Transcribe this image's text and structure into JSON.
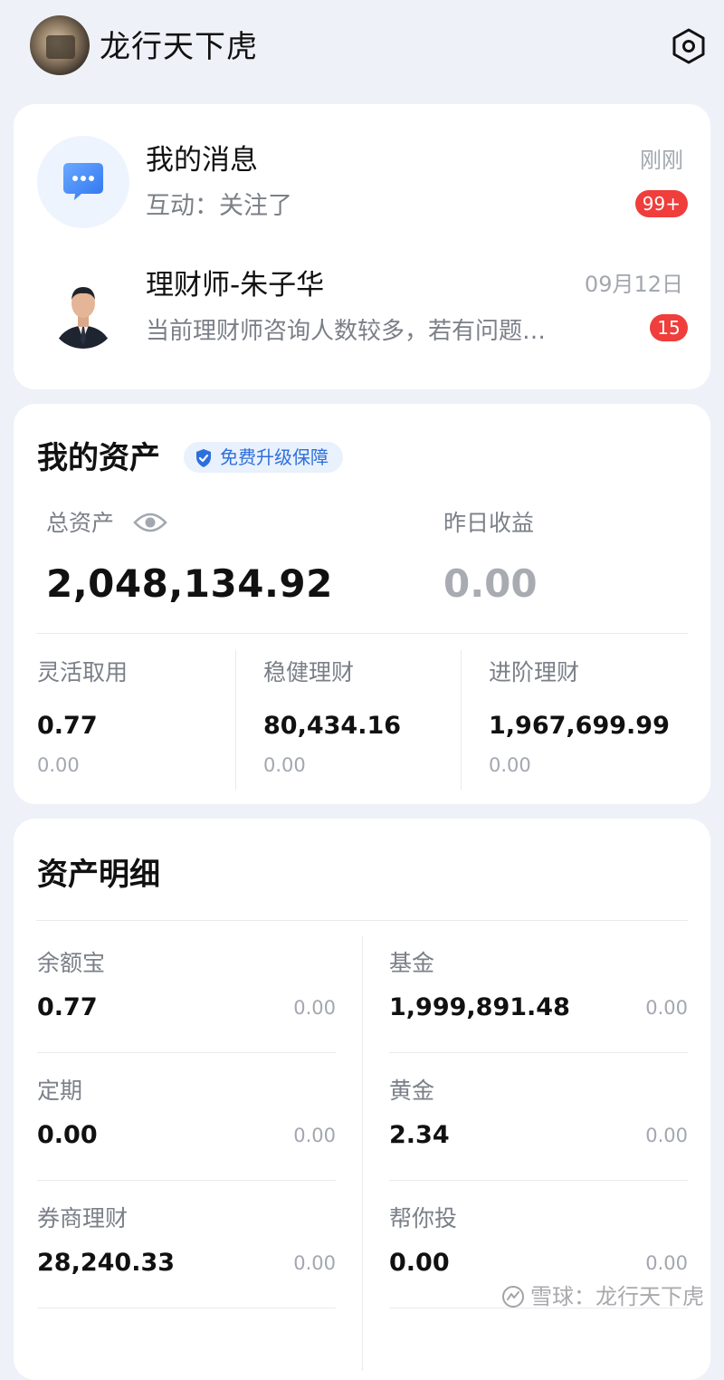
{
  "header": {
    "username": "龙行天下虎",
    "settings_icon": "settings-hex-icon"
  },
  "messages": {
    "my_messages": {
      "title": "我的消息",
      "subtitle": "互动：关注了",
      "time": "刚刚",
      "badge": "99+",
      "icon": "chat-bubble-icon"
    },
    "advisor": {
      "name": "理财师-朱子华",
      "preview": "当前理财师咨询人数较多，若有问题…",
      "time": "09月12日",
      "badge": "15"
    }
  },
  "assets": {
    "title": "我的资产",
    "protection_tag": "免费升级保障",
    "total_label": "总资产",
    "total_value": "2,048,134.92",
    "yesterday_label": "昨日收益",
    "yesterday_value": "0.00",
    "columns": [
      {
        "label": "灵活取用",
        "value": "0.77",
        "gain": "0.00"
      },
      {
        "label": "稳健理财",
        "value": "80,434.16",
        "gain": "0.00"
      },
      {
        "label": "进阶理财",
        "value": "1,967,699.99",
        "gain": "0.00"
      }
    ]
  },
  "details": {
    "title": "资产明细",
    "items": [
      {
        "name": "余额宝",
        "value": "0.77",
        "gain": "0.00"
      },
      {
        "name": "基金",
        "value": "1,999,891.48",
        "gain": "0.00"
      },
      {
        "name": "定期",
        "value": "0.00",
        "gain": "0.00"
      },
      {
        "name": "黄金",
        "value": "2.34",
        "gain": "0.00"
      },
      {
        "name": "券商理财",
        "value": "28,240.33",
        "gain": "0.00"
      },
      {
        "name": "帮你投",
        "value": "0.00",
        "gain": "0.00"
      }
    ]
  },
  "watermark": {
    "text": "雪球：龙行天下虎"
  },
  "colors": {
    "background": "#eef2f8",
    "badge": "#ef3e3b",
    "accent_blue": "#2d6fdc",
    "muted_text": "#7b7f87"
  }
}
